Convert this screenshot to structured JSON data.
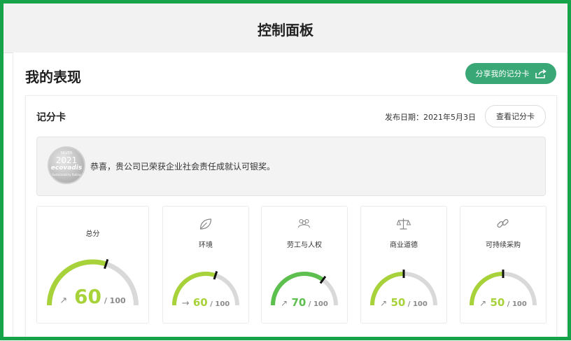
{
  "header": {
    "title": "控制面板"
  },
  "section": {
    "title": "我的表现",
    "share_label": "分享我的记分卡"
  },
  "scorecard": {
    "title": "记分卡",
    "date_label": "发布日期：2021年5月3日",
    "view_label": "查看记分卡"
  },
  "banner": {
    "badge": {
      "level": "SILVER",
      "year": "2021",
      "name": "ecovadis",
      "sub": "Sustainability Rating"
    },
    "text": "恭喜，贵公司已荣获企业社会责任成就认可银奖。"
  },
  "scores": [
    {
      "label": "总分",
      "icon": "score-icon",
      "arrow": "↗",
      "value": "60",
      "max": "/ 100",
      "fraction": 0.6,
      "color": "#a8d23a"
    },
    {
      "label": "环境",
      "icon": "leaf-icon",
      "arrow": "→",
      "value": "60",
      "max": "/ 100",
      "fraction": 0.6,
      "color": "#a8d23a"
    },
    {
      "label": "劳工与人权",
      "icon": "people-icon",
      "arrow": "↗",
      "value": "70",
      "max": "/ 100",
      "fraction": 0.7,
      "color": "#5cbf4e"
    },
    {
      "label": "商业道德",
      "icon": "scales-icon",
      "arrow": "↗",
      "value": "50",
      "max": "/ 100",
      "fraction": 0.5,
      "color": "#a8d23a"
    },
    {
      "label": "可持续采购",
      "icon": "chain-icon",
      "arrow": "↗",
      "value": "50",
      "max": "/ 100",
      "fraction": 0.5,
      "color": "#a8d23a"
    }
  ],
  "colors": {
    "accent": "#3aa876",
    "frame": "#16a34a",
    "track": "#d9d9d9"
  }
}
